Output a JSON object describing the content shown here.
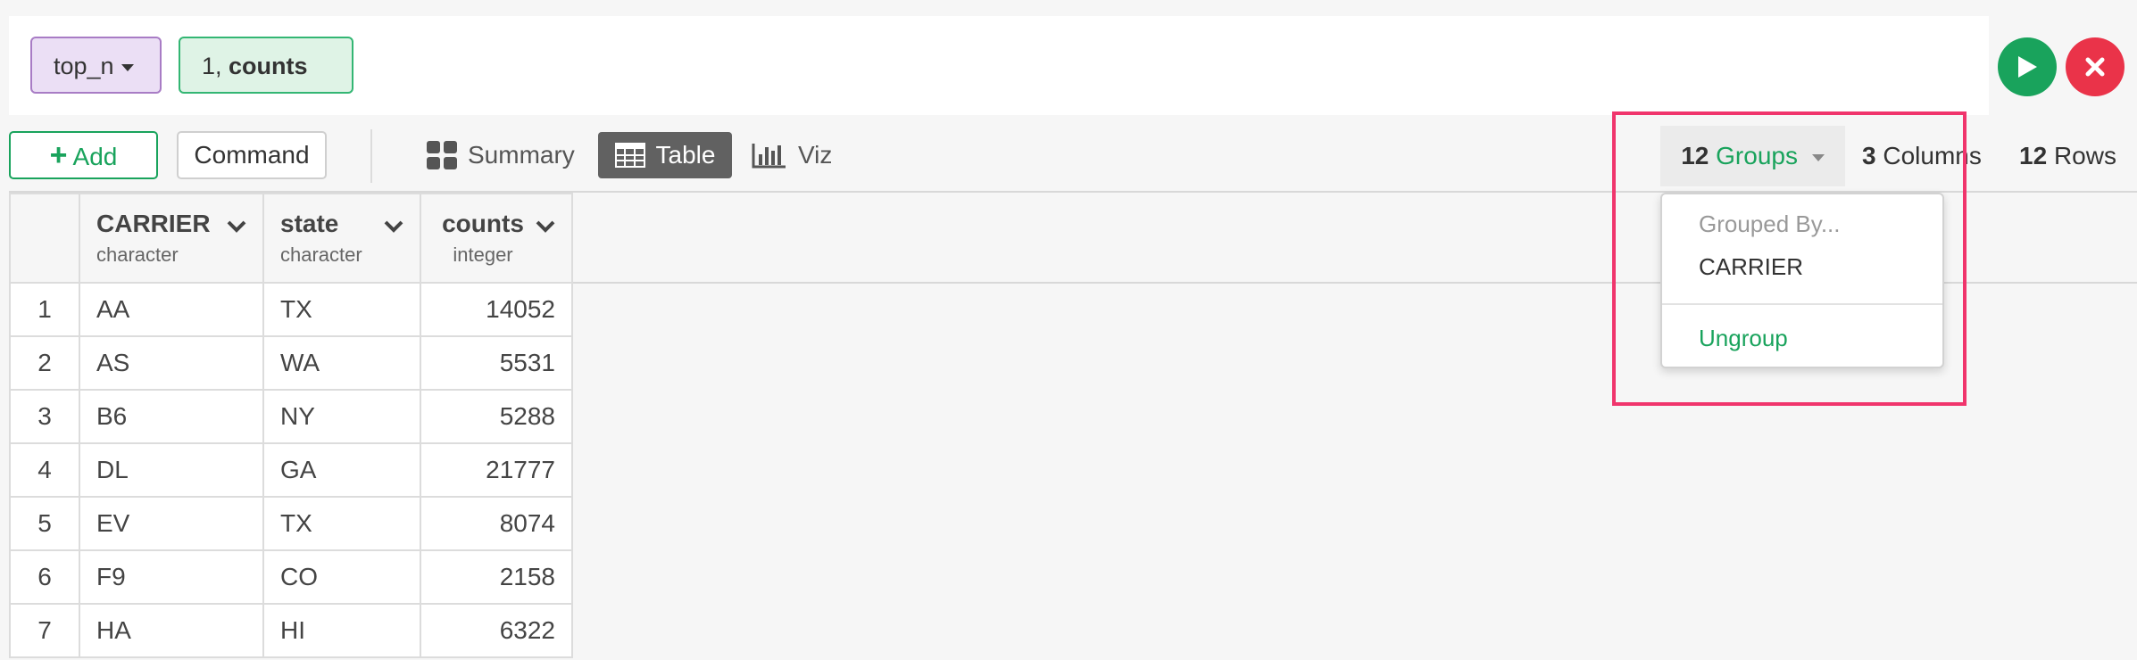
{
  "command": {
    "function_token": "top_n",
    "arg_prefix": "1, ",
    "arg_bold": "counts"
  },
  "toolbar": {
    "add_label": "Add",
    "command_label": "Command",
    "summary_label": "Summary",
    "table_label": "Table",
    "viz_label": "Viz",
    "active_view": "Table"
  },
  "stats": {
    "groups_count": "12",
    "groups_label": "Groups",
    "columns_count": "3",
    "columns_label": "Columns",
    "rows_count": "12",
    "rows_label": "Rows"
  },
  "groups_menu": {
    "header": "Grouped By...",
    "grouped_column": "CARRIER",
    "ungroup_label": "Ungroup"
  },
  "table": {
    "columns": [
      {
        "name": "CARRIER",
        "type": "character"
      },
      {
        "name": "state",
        "type": "character"
      },
      {
        "name": "counts",
        "type": "integer"
      }
    ],
    "rows": [
      {
        "n": "1",
        "carrier": "AA",
        "state": "TX",
        "counts": "14052"
      },
      {
        "n": "2",
        "carrier": "AS",
        "state": "WA",
        "counts": "5531"
      },
      {
        "n": "3",
        "carrier": "B6",
        "state": "NY",
        "counts": "5288"
      },
      {
        "n": "4",
        "carrier": "DL",
        "state": "GA",
        "counts": "21777"
      },
      {
        "n": "5",
        "carrier": "EV",
        "state": "TX",
        "counts": "8074"
      },
      {
        "n": "6",
        "carrier": "F9",
        "state": "CO",
        "counts": "2158"
      },
      {
        "n": "7",
        "carrier": "HA",
        "state": "HI",
        "counts": "6322"
      }
    ]
  },
  "colors": {
    "accent_green": "#19a35c",
    "cancel_red": "#ea3349",
    "highlight_pink": "#f0356c",
    "function_purple": "#ebdff5"
  },
  "icons": [
    "caret-down-icon",
    "play-icon",
    "close-icon",
    "plus-icon",
    "summary-grid-icon",
    "table-icon",
    "bar-chart-icon",
    "chevron-down-icon"
  ]
}
